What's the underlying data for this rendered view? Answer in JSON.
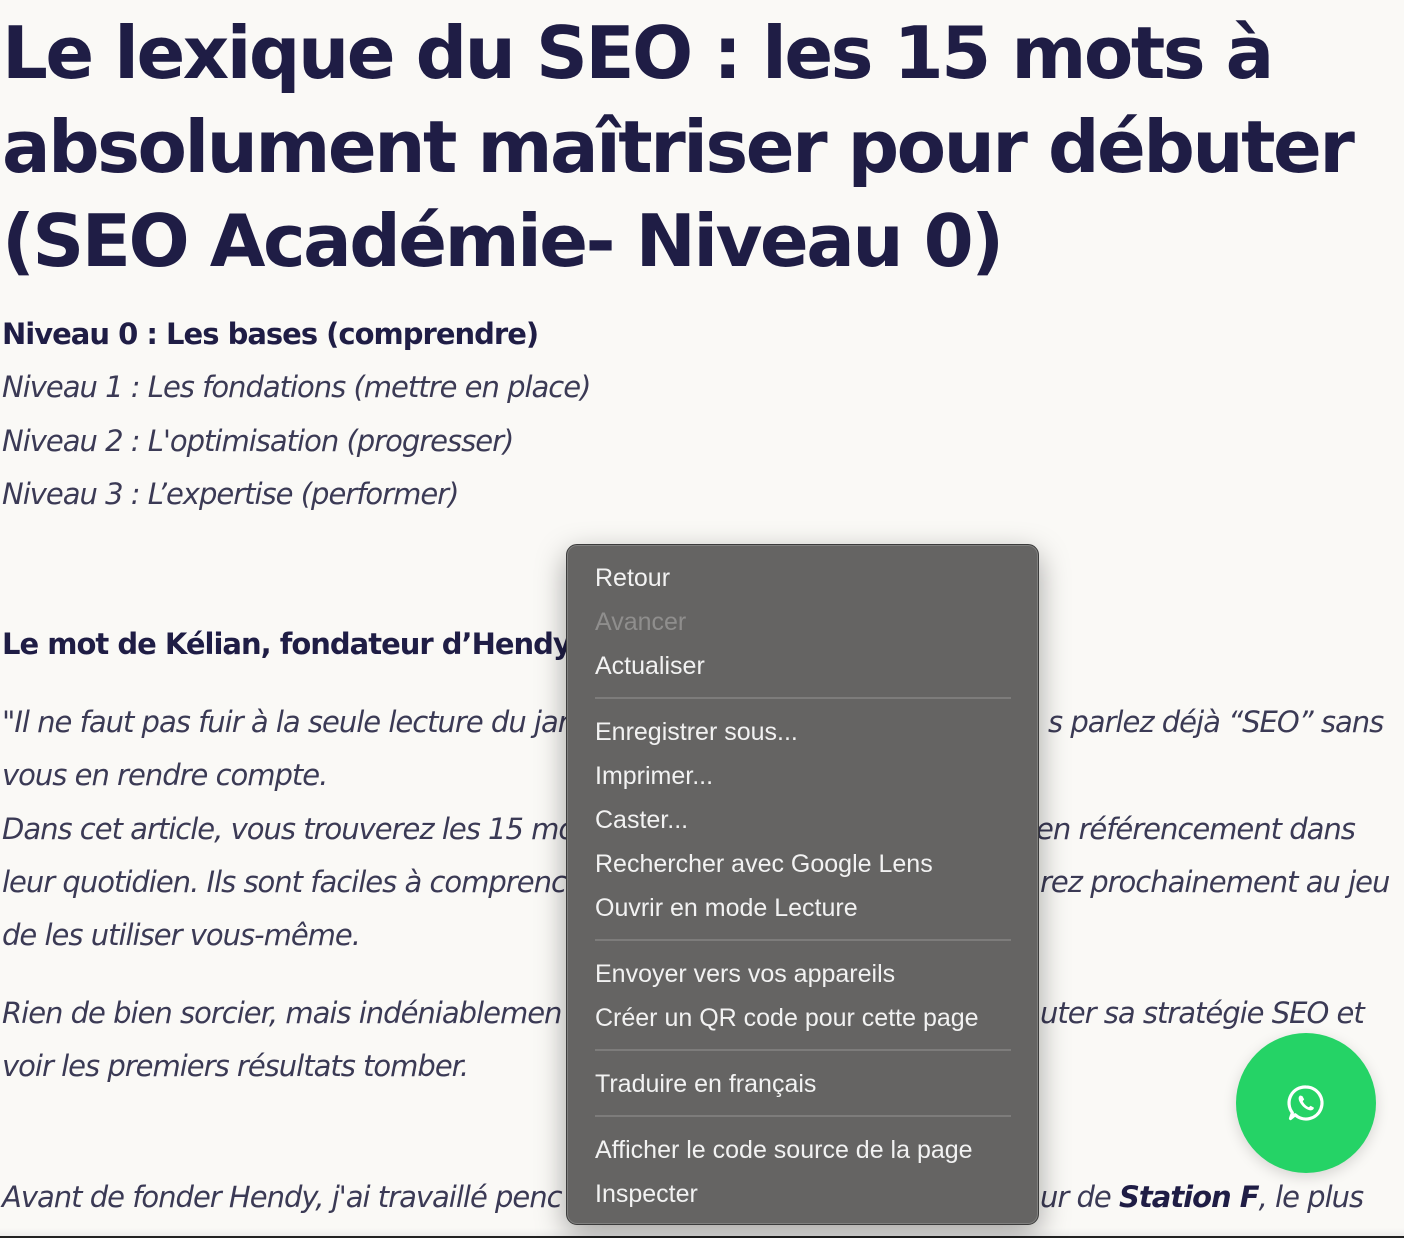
{
  "article": {
    "title": "Le lexique du SEO : les 15 mots à absolument maîtriser pour débuter (SEO Académie- Niveau 0)",
    "levels": [
      {
        "label": "Niveau 0 : Les bases (comprendre)",
        "current": true
      },
      {
        "label": "Niveau 1 : Les fondations (mettre en place)",
        "current": false
      },
      {
        "label": "Niveau 2 : L'optimisation (progresser)",
        "current": false
      },
      {
        "label": "Niveau 3 : L’expertise (performer)",
        "current": false
      }
    ],
    "subheading": "Le mot de Kélian, fondateur d’Hendy",
    "visible_lines": {
      "l1_left": "\"Il ne faut pas fuir à la seule lecture du jar",
      "l1_right": "s parlez déjà “SEO” sans",
      "l2": "vous en rendre compte.",
      "l3_left": "Dans cet article, vous trouverez les 15 mo",
      "l3_right": "en référencement dans",
      "l4_left": "leur quotidien. Ils sont faciles à comprenc",
      "l4_right": "rez prochainement au jeu",
      "l5": "de les utiliser vous-même.",
      "l6_left": "Rien de bien sorcier, mais indéniablemen",
      "l6_right": "uter sa stratégie SEO et",
      "l7": "voir les premiers résultats tomber.",
      "l8_left": "Avant de fonder Hendy, j'ai travaillé penc",
      "l8_right_pre": "ur de ",
      "l8_right_bold": "Station F",
      "l8_right_post": ", le plus"
    }
  },
  "context_menu": {
    "groups": [
      [
        {
          "label": "Retour",
          "enabled": true
        },
        {
          "label": "Avancer",
          "enabled": false
        },
        {
          "label": "Actualiser",
          "enabled": true
        }
      ],
      [
        {
          "label": "Enregistrer sous...",
          "enabled": true
        },
        {
          "label": "Imprimer...",
          "enabled": true
        },
        {
          "label": "Caster...",
          "enabled": true
        },
        {
          "label": "Rechercher avec Google Lens",
          "enabled": true
        },
        {
          "label": "Ouvrir en mode Lecture",
          "enabled": true
        }
      ],
      [
        {
          "label": "Envoyer vers vos appareils",
          "enabled": true
        },
        {
          "label": "Créer un QR code pour cette page",
          "enabled": true
        }
      ],
      [
        {
          "label": "Traduire en français",
          "enabled": true
        }
      ],
      [
        {
          "label": "Afficher le code source de la page",
          "enabled": true
        },
        {
          "label": "Inspecter",
          "enabled": true
        }
      ]
    ]
  },
  "whatsapp_button": {
    "icon": "whatsapp-icon",
    "color": "#25d366"
  }
}
